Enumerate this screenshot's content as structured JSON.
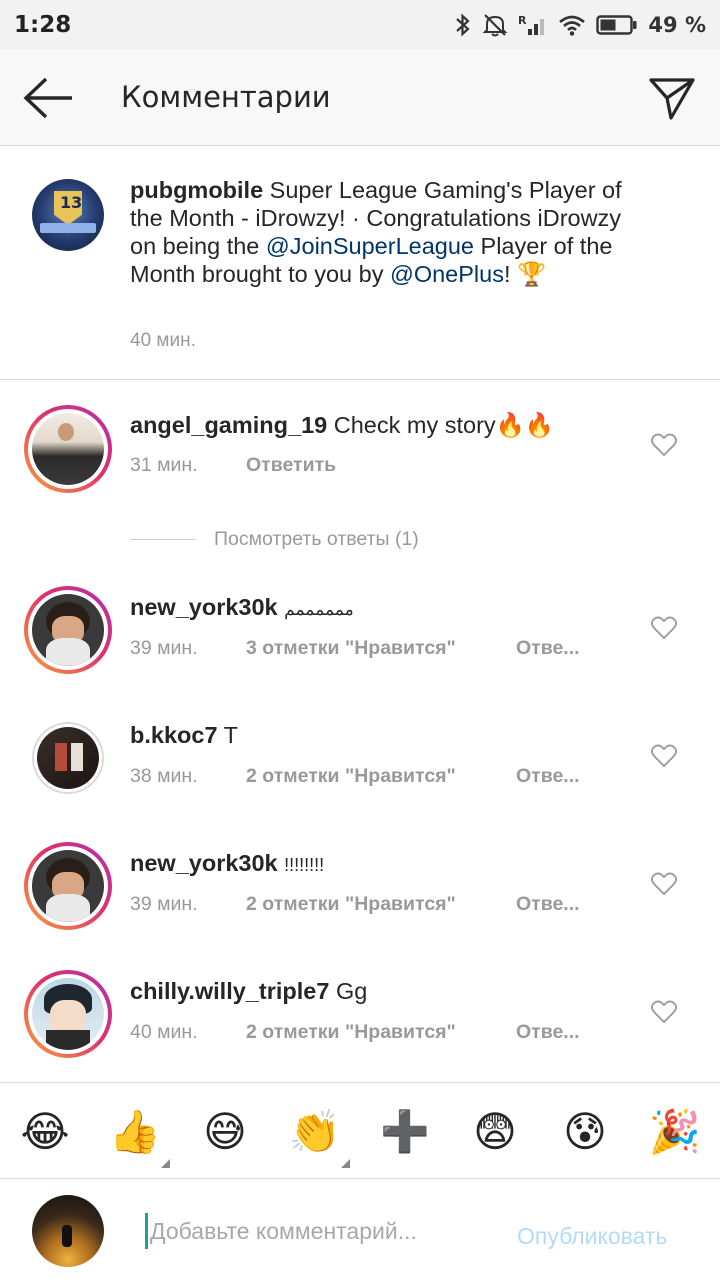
{
  "status_bar": {
    "time": "1:28",
    "battery": "49 %",
    "icons": [
      "bluetooth-icon",
      "mute-icon",
      "signal-icon",
      "wifi-icon",
      "battery-icon"
    ]
  },
  "header": {
    "title": "Комментарии",
    "back_icon": "arrow-left-icon",
    "send_icon": "paper-plane-icon"
  },
  "caption": {
    "username": "pubgmobile",
    "text_part1": " Super League Gaming's Player of the Month - iDrowzy!  ·  Congratulations iDrowzy on being the ",
    "mention1": "@JoinSuperLeague",
    "text_part2": " Player of the Month brought to you by ",
    "mention2": "@OnePlus",
    "text_part3": "! 🏆",
    "time": "40 мин.",
    "avatar_badge": "13"
  },
  "comments": [
    {
      "username": "angel_gaming_19",
      "text": "Check my story🔥🔥",
      "time": "31 мин.",
      "likes": "",
      "reply": "Ответить"
    },
    {
      "username": "new_york30k",
      "text": "ممممممم",
      "time": "39 мин.",
      "likes": "3 отметки \"Нравится\"",
      "reply": "Отве..."
    },
    {
      "username": "b.kkoc7",
      "text": "T",
      "time": "38 мин.",
      "likes": "2 отметки \"Нравится\"",
      "reply": "Отве..."
    },
    {
      "username": "new_york30k",
      "text": "!!!!!!!!",
      "time": "39 мин.",
      "likes": "2 отметки \"Нравится\"",
      "reply": "Отве..."
    },
    {
      "username": "chilly.willy_triple7",
      "text": "Gg",
      "time": "40 мин.",
      "likes": "2 отметки \"Нравится\"",
      "reply": "Отве..."
    }
  ],
  "view_replies": "Посмотреть ответы (1)",
  "emoji_bar": [
    "😂",
    "👍",
    "😅",
    "👏",
    "➕",
    "😨",
    "😰",
    "🎉"
  ],
  "composer": {
    "placeholder": "Добавьте комментарий...",
    "publish_label": "Опубликовать"
  }
}
